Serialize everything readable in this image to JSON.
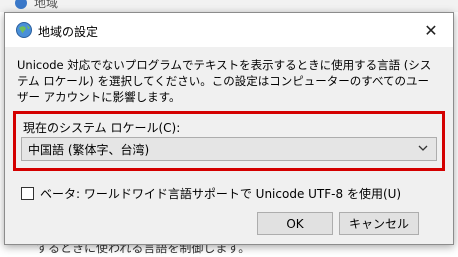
{
  "background": {
    "title": "地域",
    "footer_text": "するときに使われる言語を制御します。"
  },
  "dialog": {
    "title": "地域の設定",
    "close_glyph": "✕",
    "description": "Unicode 対応でないプログラムでテキストを表示するときに使用する言語 (システム ロケール) を選択してください。この設定はコンピューターのすべてのユーザー アカウントに影響します。",
    "locale_label": "現在のシステム ロケール(C):",
    "locale_value": "中国語 (繁体字、台湾)",
    "beta_label": "ベータ: ワールドワイド言語サポートで Unicode UTF-8 を使用(U)",
    "beta_checked": false,
    "ok_label": "OK",
    "cancel_label": "キャンセル"
  },
  "colors": {
    "highlight": "#d40000",
    "dialog_bg": "#f0f0f0",
    "button_bg": "#e1e1e1"
  }
}
